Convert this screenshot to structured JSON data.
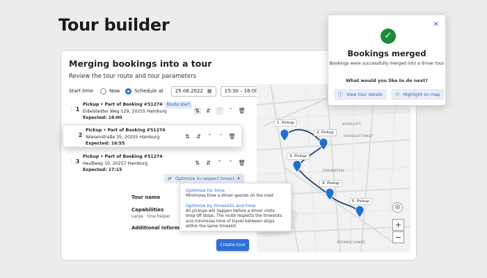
{
  "page": {
    "title": "Tour builder"
  },
  "card": {
    "title": "Merging bookings into a tour",
    "subtitle": "Review the tour route and tour parameters",
    "start_time": {
      "label": "Start time",
      "now_label": "Now",
      "schedule_label": "Schedule at",
      "date": "25.08.2022",
      "time_range": "15:30 – 16:00",
      "selected": "schedule"
    },
    "stops": [
      {
        "number": "1",
        "title": "Pickup • Part of Booking #51274",
        "badge": "Route start",
        "address": "Eidelstedter Weg 129, 20255 Hamburg",
        "expected": "Expected: 16:00"
      },
      {
        "number": "2",
        "title": "Pickup • Part of Booking #51274",
        "badge": "",
        "address": "Wiesenstraße 35, 20255 Hamburg",
        "expected": "Expected: 16:55"
      },
      {
        "number": "3",
        "title": "Pickup • Part of Booking #51274",
        "badge": "",
        "address": "Heußweg 10, 20257 Hamburg",
        "expected": "Expected: 17:15"
      }
    ],
    "optimize": {
      "button_label": "Optimize to respect timeslots",
      "options": [
        {
          "title": "Optimize for time",
          "desc": "Minimizes time a driver spends on the road"
        },
        {
          "title": "Optimize by timeslots and time",
          "desc": "All pickups will happen before a driver visits drop-off stops. The route respects the timeslots and minimizes time of travel between stops within the same timeslot."
        }
      ]
    },
    "fields": {
      "tour_name": "Tour name",
      "capabilities": "Capabilities",
      "capabilities_value": "Large · One helper",
      "additional_info": "Additional information"
    },
    "create_label": "Create tour"
  },
  "map": {
    "labels": [
      "HOHELUFT",
      "HOHELUFT-WEST",
      "EIMSBÜTTEL",
      "STERNSCHANZE"
    ],
    "pins": [
      {
        "label": "1. Pickup"
      },
      {
        "label": "2. Pickup"
      },
      {
        "label": "3. Pickup"
      },
      {
        "label": "4. Pickup"
      },
      {
        "label": "5. Pickup"
      }
    ],
    "zoom_in": "+",
    "zoom_out": "−",
    "accent": "#1f6fd1"
  },
  "popover": {
    "title": "Bookings merged",
    "desc": "Bookings were successfully merged into a driver tour",
    "question": "What would you like to do next?",
    "view_label": "View tour details",
    "highlight_label": "Highlight on map"
  },
  "colors": {
    "primary": "#2f6fd6",
    "success": "#1a8a3b",
    "badge_bg": "#dde9fb"
  }
}
